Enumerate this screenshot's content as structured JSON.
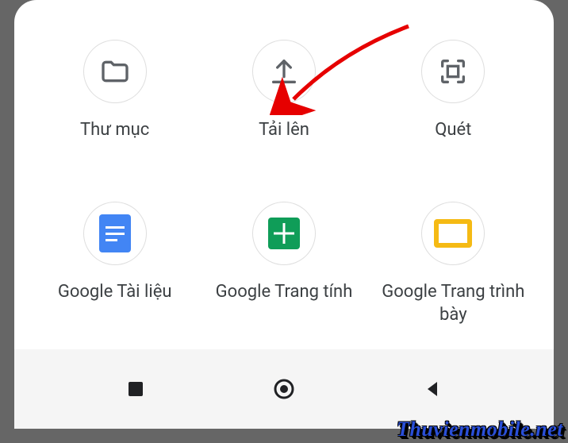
{
  "options": [
    {
      "id": "folder",
      "label": "Thư mục"
    },
    {
      "id": "upload",
      "label": "Tải lên"
    },
    {
      "id": "scan",
      "label": "Quét"
    },
    {
      "id": "docs",
      "label": "Google Tài liệu"
    },
    {
      "id": "sheets",
      "label": "Google Trang tính"
    },
    {
      "id": "slides",
      "label": "Google Trang trình bày"
    }
  ],
  "watermark": "Thuvienmobile.net"
}
